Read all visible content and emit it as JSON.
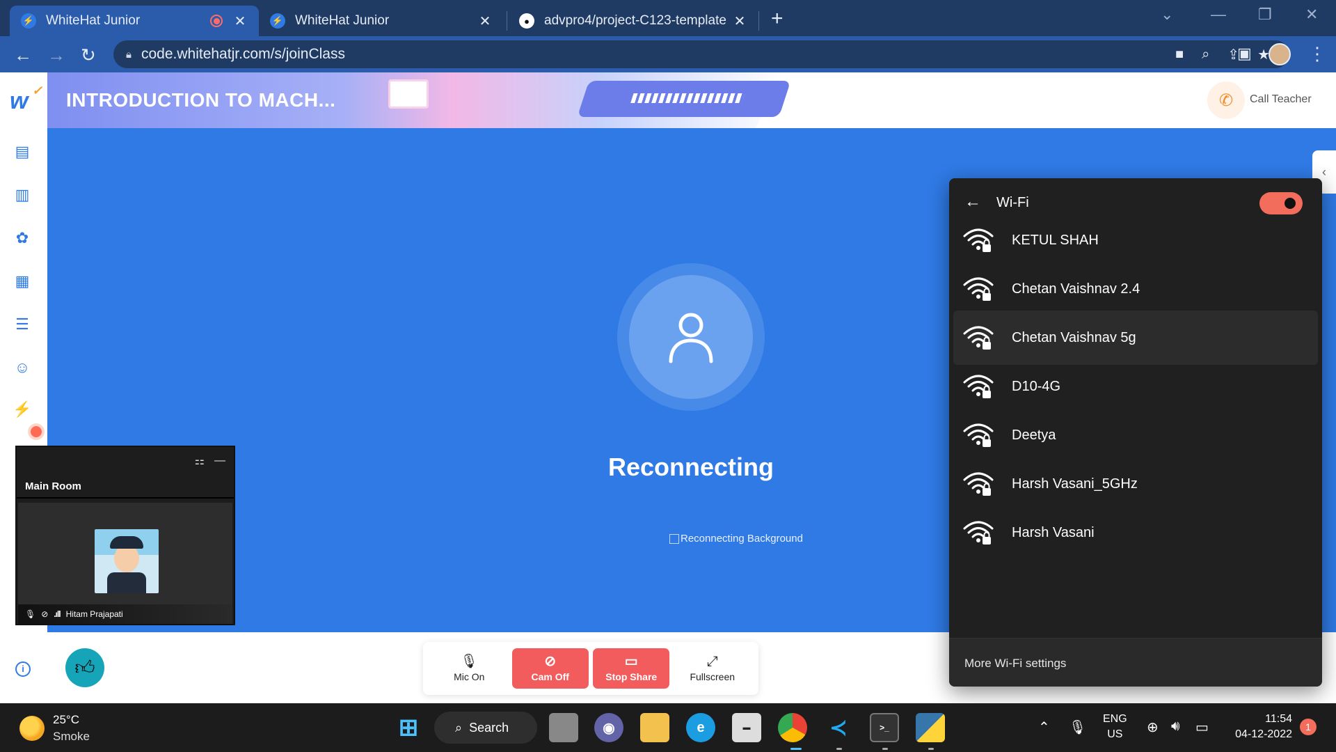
{
  "browser": {
    "tabs": [
      {
        "title": "WhiteHat Junior",
        "close": "✕"
      },
      {
        "title": "WhiteHat Junior",
        "close": "✕"
      },
      {
        "title": "advpro4/project-C123-template",
        "close": "✕"
      }
    ],
    "new_tab": "+",
    "url": "code.whitehatjr.com/s/joinClass"
  },
  "header": {
    "course_title": "INTRODUCTION TO MACH...",
    "call_label": "Call Teacher"
  },
  "stage": {
    "status": "Reconnecting",
    "image_alt": "Reconnecting Background"
  },
  "float_window": {
    "title": "Main Room",
    "participant": "Hitam Prajapati"
  },
  "controls": {
    "mic": "Mic On",
    "cam": "Cam Off",
    "share": "Stop Share",
    "fullscreen": "Fullscreen"
  },
  "wifi": {
    "title": "Wi-Fi",
    "enabled": true,
    "networks": [
      {
        "name": "KETUL SHAH",
        "secured": true,
        "selected": false
      },
      {
        "name": "Chetan Vaishnav 2.4",
        "secured": true,
        "selected": false
      },
      {
        "name": "Chetan Vaishnav 5g",
        "secured": true,
        "selected": true
      },
      {
        "name": "D10-4G",
        "secured": true,
        "selected": false
      },
      {
        "name": "Deetya",
        "secured": true,
        "selected": false
      },
      {
        "name": "Harsh Vasani_5GHz",
        "secured": true,
        "selected": false
      },
      {
        "name": "Harsh Vasani",
        "secured": true,
        "selected": false
      }
    ],
    "more_settings": "More Wi-Fi settings"
  },
  "taskbar": {
    "weather_temp": "25°C",
    "weather_desc": "Smoke",
    "search_label": "Search",
    "lang_line1": "ENG",
    "lang_line2": "US",
    "time": "11:54",
    "date": "04-12-2022",
    "notification_count": "1"
  },
  "colors": {
    "brand_blue": "#2f7ae5",
    "danger_red": "#f25c5c",
    "wifi_toggle": "#f26d5b"
  }
}
